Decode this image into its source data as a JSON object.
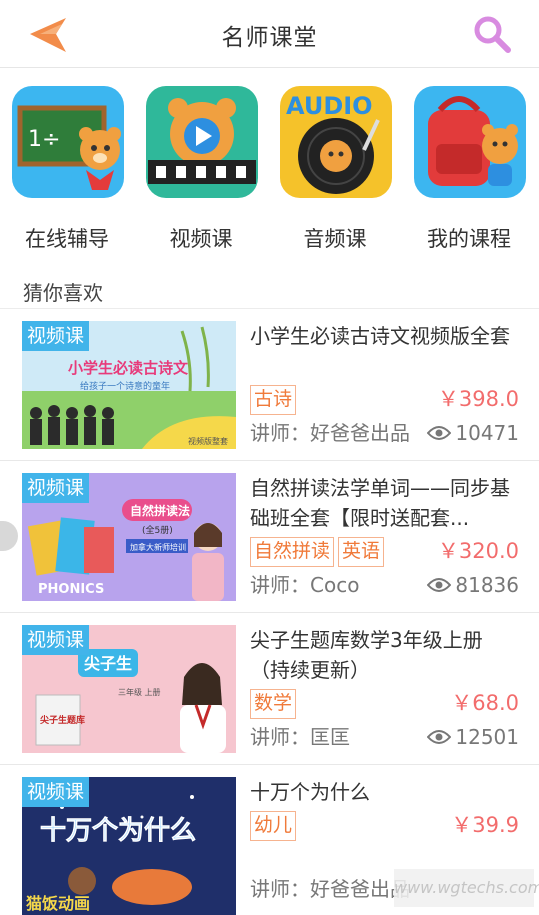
{
  "header": {
    "title": "名师课堂",
    "back_icon": "back-arrow-icon",
    "search_icon": "search-icon",
    "accent": "#f28c4a"
  },
  "categories": [
    {
      "label": "在线辅导",
      "icon": "chalkboard-bear-icon"
    },
    {
      "label": "视频课",
      "icon": "film-bear-icon"
    },
    {
      "label": "音频课",
      "icon": "record-bear-icon"
    },
    {
      "label": "我的课程",
      "icon": "backpack-bear-icon"
    }
  ],
  "section_title": "猜你喜欢",
  "courses": [
    {
      "badge": "视频课",
      "title": "小学生必读古诗文视频版全套",
      "tags": [
        "古诗"
      ],
      "price": "￥398.0",
      "teacher": "讲师：好爸爸出品",
      "views": "10471",
      "thumb": {
        "headline": "小学生必读古诗文",
        "sub": "给孩子一个诗意的童年",
        "corner": "视频版整套"
      }
    },
    {
      "badge": "视频课",
      "title": "自然拼读法学单词——同步基础班全套【限时送配套...",
      "tags": [
        "自然拼读",
        "英语"
      ],
      "price": "￥320.0",
      "teacher": "讲师：Coco",
      "views": "81836",
      "thumb": {
        "headline": "自然拼读法",
        "sub": "(全5册)",
        "extra": "加拿大新师培训",
        "brand": "PHONICS"
      }
    },
    {
      "badge": "视频课",
      "title": "尖子生题库数学3年级上册（持续更新）",
      "tags": [
        "数学"
      ],
      "price": "￥68.0",
      "teacher": "讲师：匡匡",
      "views": "12501",
      "thumb": {
        "headline": "尖子生",
        "sub": "三年级 上册",
        "book": "尖子生题库"
      }
    },
    {
      "badge": "视频课",
      "title": "十万个为什么",
      "tags": [
        "幼儿"
      ],
      "price": "￥39.9",
      "teacher": "讲师：好爸爸出品",
      "views": "",
      "thumb": {
        "headline": "十万个为什么",
        "logo": "猫饭动画"
      }
    }
  ],
  "watermark": "www.wgtechs.com"
}
